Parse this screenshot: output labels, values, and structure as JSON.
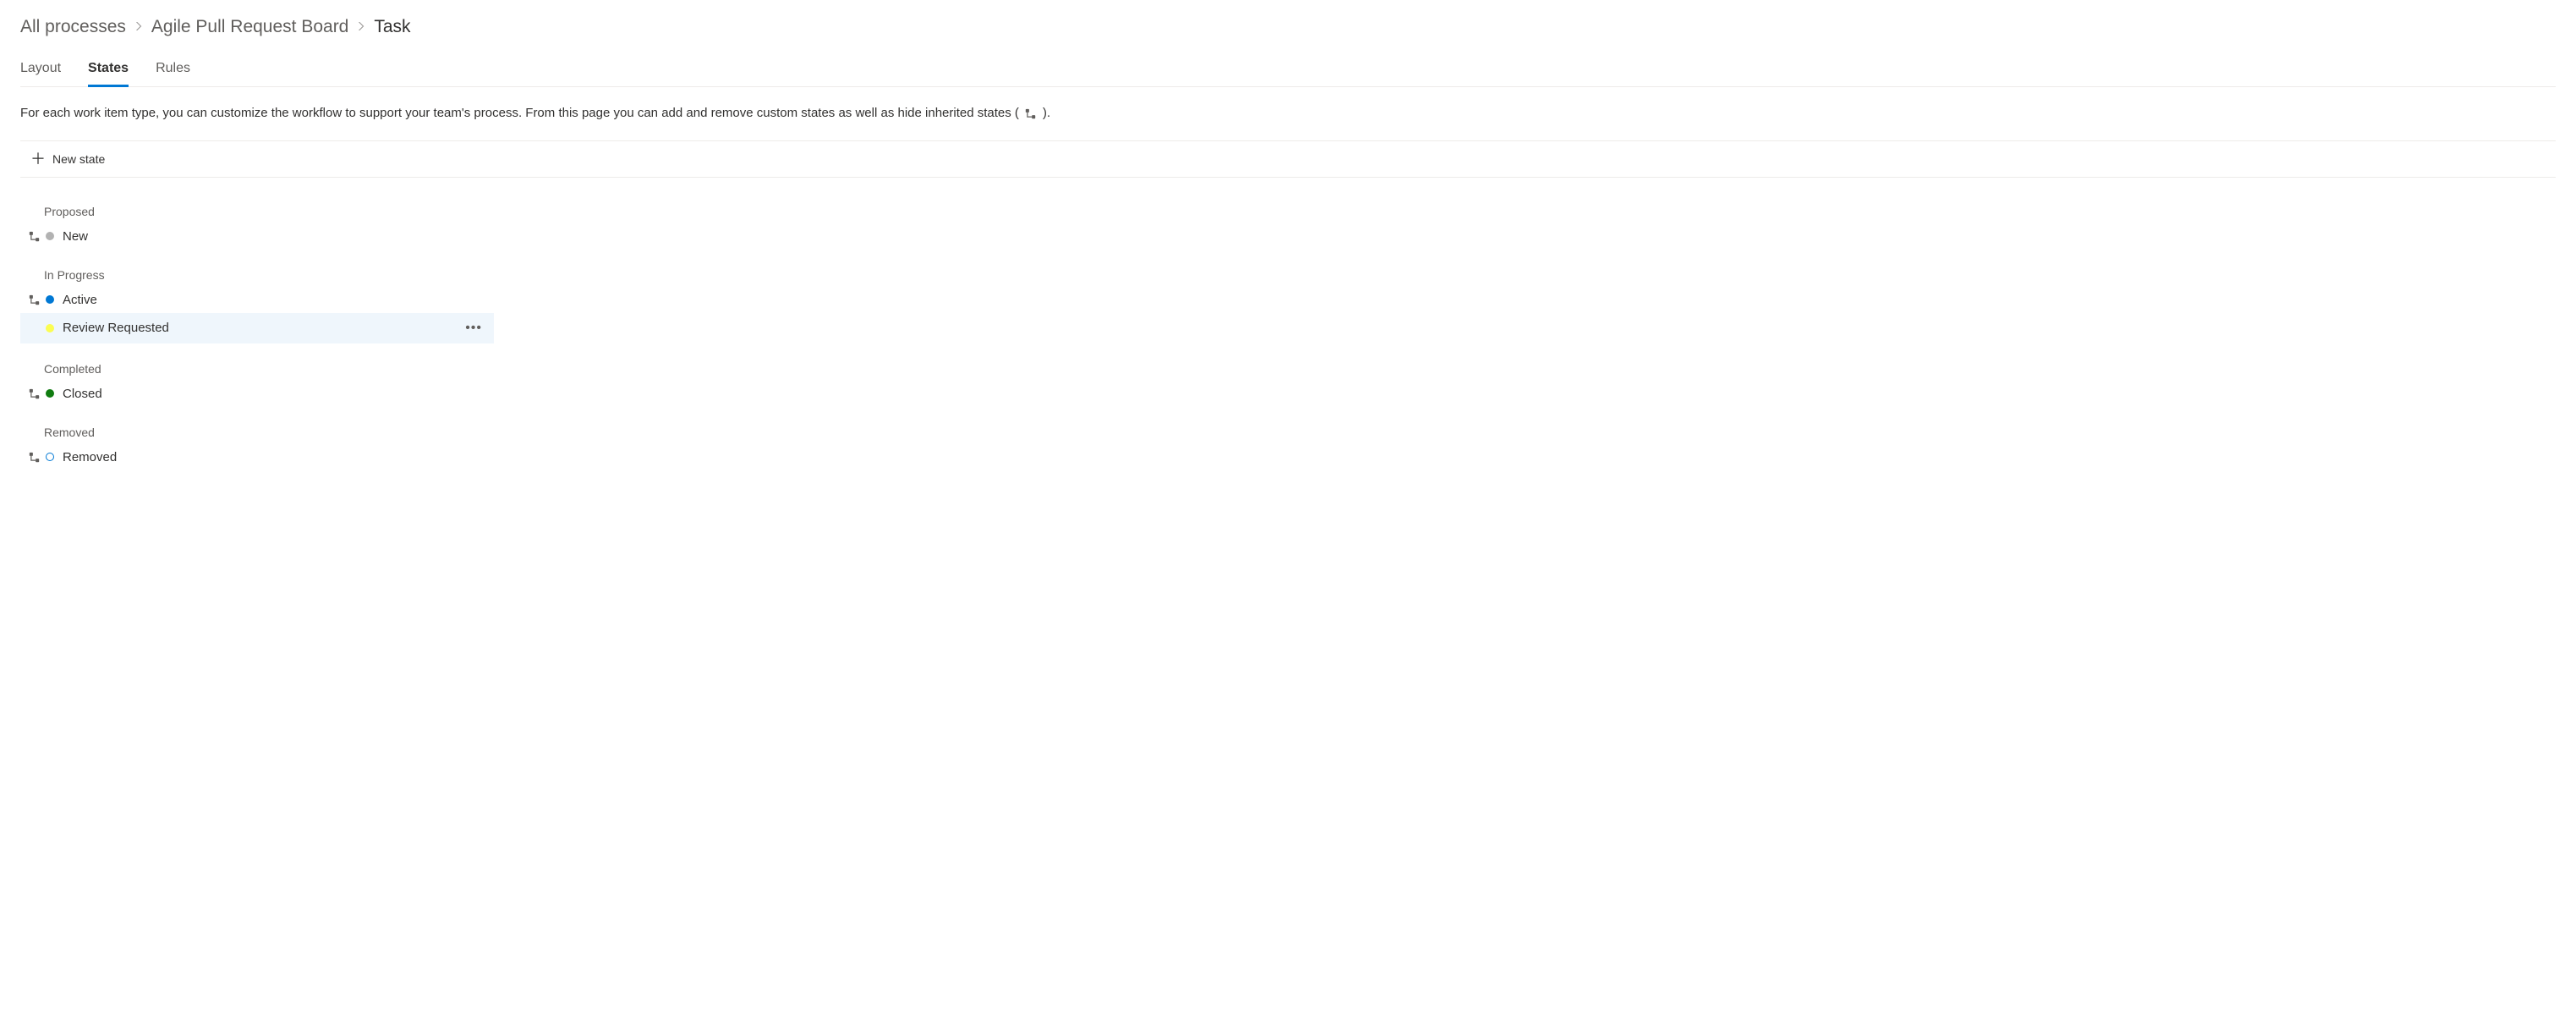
{
  "breadcrumb": {
    "items": [
      {
        "label": "All processes"
      },
      {
        "label": "Agile Pull Request Board"
      },
      {
        "label": "Task"
      }
    ]
  },
  "tabs": [
    {
      "id": "layout",
      "label": "Layout",
      "active": false
    },
    {
      "id": "states",
      "label": "States",
      "active": true
    },
    {
      "id": "rules",
      "label": "Rules",
      "active": false
    }
  ],
  "description_pre": "For each work item type, you can customize the workflow to support your team's process. From this page you can add and remove custom states as well as hide inherited states (",
  "description_post": ").",
  "toolbar": {
    "new_state_label": "New state"
  },
  "categories": [
    {
      "name": "Proposed",
      "states": [
        {
          "name": "New",
          "color": "#b2b2b2",
          "inherited": true,
          "outline": false,
          "selected": false
        }
      ]
    },
    {
      "name": "In Progress",
      "states": [
        {
          "name": "Active",
          "color": "#0078d4",
          "inherited": true,
          "outline": false,
          "selected": false
        },
        {
          "name": "Review Requested",
          "color": "#fbfd52",
          "inherited": false,
          "outline": false,
          "selected": true
        }
      ]
    },
    {
      "name": "Completed",
      "states": [
        {
          "name": "Closed",
          "color": "#107c10",
          "inherited": true,
          "outline": false,
          "selected": false
        }
      ]
    },
    {
      "name": "Removed",
      "states": [
        {
          "name": "Removed",
          "color": "#0078d4",
          "inherited": true,
          "outline": true,
          "selected": false
        }
      ]
    }
  ]
}
